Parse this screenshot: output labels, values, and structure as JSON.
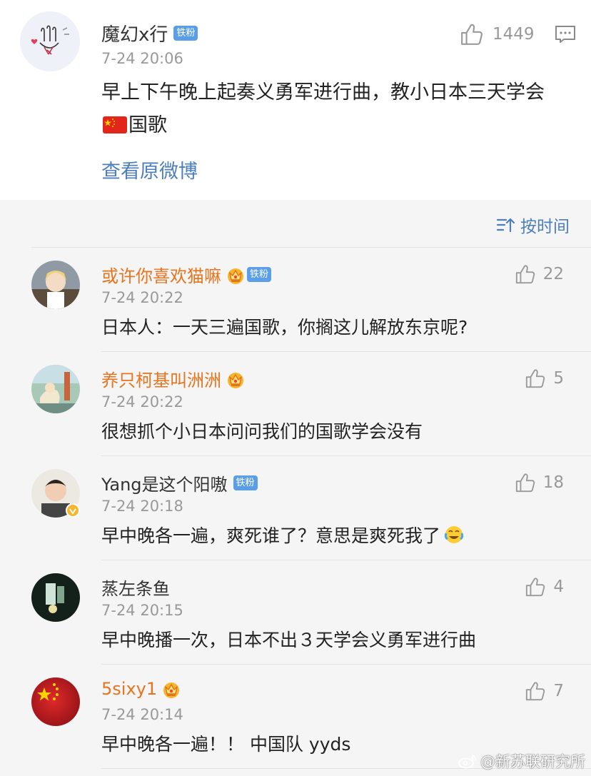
{
  "post": {
    "username": "魔幻x行",
    "badge": "铁粉",
    "time": "7-24 20:06",
    "likes": "1449",
    "text_before_flag": "早上下午晚上起奏义勇军进行曲，教小日本三天学会",
    "text_after_flag": "国歌",
    "view_original": "查看原微博"
  },
  "sort": {
    "label": "按时间"
  },
  "comments": [
    {
      "username": "或许你喜欢猫嘛",
      "badge": "铁粉",
      "time": "7-24 20:22",
      "text": "日本人：一天三遍国歌，你搁这儿解放东京呢?",
      "likes": "22"
    },
    {
      "username": "养只柯基叫洲洲",
      "badge": "",
      "time": "7-24 20:22",
      "text": "很想抓个小日本问问我们的国歌学会没有",
      "likes": "5"
    },
    {
      "username": "Yang是这个阳嗷",
      "badge": "铁粉",
      "time": "7-24 20:18",
      "text": "早中晚各一遍，爽死谁了？意思是爽死我了",
      "likes": "18"
    },
    {
      "username": "蒸左条鱼",
      "badge": "",
      "time": "7-24 20:15",
      "text": "早中晚播一次，日本不出３天学会义勇军进行曲",
      "likes": "4"
    },
    {
      "username": "5sixy1",
      "badge": "",
      "time": "7-24 20:14",
      "text": "早中晚各一遍！！ 中国队 yyds",
      "likes": "7"
    }
  ],
  "watermark": "@新苏联研究所"
}
